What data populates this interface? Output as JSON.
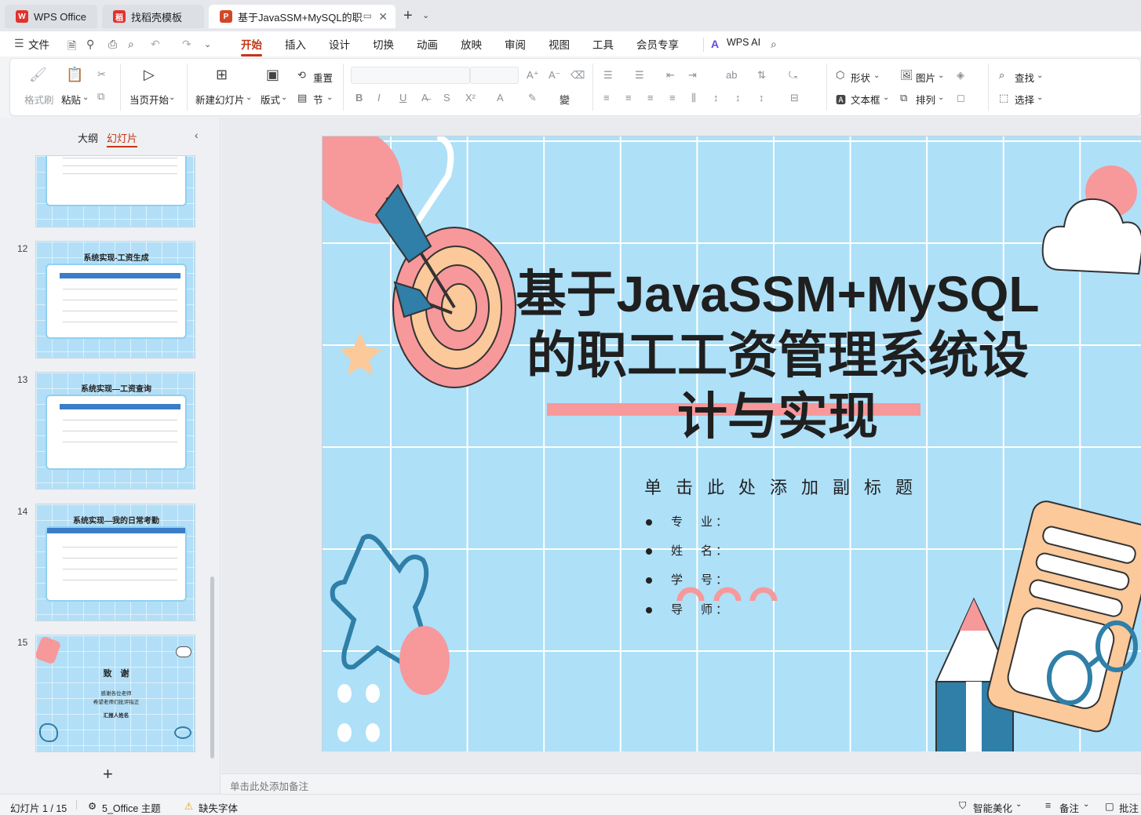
{
  "tabs": [
    {
      "label": "WPS Office",
      "icon": "wps-logo-icon",
      "color": "#e2322d"
    },
    {
      "label": "找稻壳模板",
      "icon": "docer-icon",
      "color": "#e2322d"
    },
    {
      "label": "基于JavaSSM+MySQL的职工",
      "icon": "ppt-icon",
      "color": "#d24726"
    }
  ],
  "menu": {
    "file": "文件",
    "items": [
      "开始",
      "插入",
      "设计",
      "切换",
      "动画",
      "放映",
      "审阅",
      "视图",
      "工具",
      "会员专享"
    ],
    "active": "开始",
    "wps_ai": "WPS AI"
  },
  "ribbon": {
    "format_painter": "格式刷",
    "paste": "粘贴",
    "start_from_current": "当页开始",
    "new_slide": "新建幻灯片",
    "layout": "版式",
    "reset": "重置",
    "section": "节",
    "shape": "形状",
    "picture": "图片",
    "textbox": "文本框",
    "arrange": "排列",
    "find": "查找",
    "select": "选择"
  },
  "left_panel": {
    "tab_outline": "大纲",
    "tab_slides": "幻灯片",
    "thumbs": [
      {
        "num": "12",
        "title": "系统实现-工资生成"
      },
      {
        "num": "13",
        "title": "系统实现—工资查询"
      },
      {
        "num": "14",
        "title": "系统实现—我的日常考勤"
      },
      {
        "num": "15",
        "title": "致　谢",
        "line1": "感谢各位老师",
        "line2": "希望老师们批评指正",
        "line3": "汇报人姓名"
      }
    ],
    "add": "+"
  },
  "slide": {
    "title_line1": "基于JavaSSM+MySQL",
    "title_line2": "的职工工资管理系统设",
    "title_line3": "计与实现",
    "subtitle": "单击此处添加副标题",
    "info": [
      "专　业：",
      "姓　名：",
      "学　号：",
      "导　师："
    ],
    "colors": {
      "bg": "#aee0f8",
      "pink": "#f7989b",
      "peach": "#fbc99a",
      "blue": "#2f7fa8"
    }
  },
  "notes_placeholder": "单击此处添加备注",
  "status": {
    "slide_count": "幻灯片 1 / 15",
    "theme": "5_Office 主题",
    "missing_font": "缺失字体",
    "smart_beautify": "智能美化",
    "notes": "备注",
    "comments": "批注"
  }
}
